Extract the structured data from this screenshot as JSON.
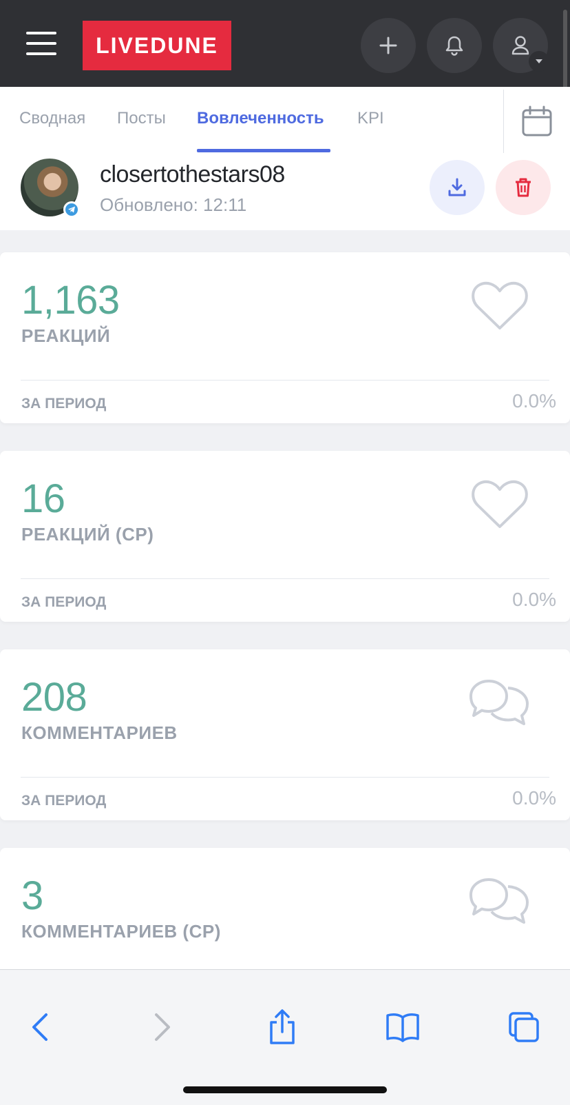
{
  "app": {
    "logo": "LIVEDUNE"
  },
  "tabs": [
    "Сводная",
    "Посты",
    "Вовлеченность",
    "KPI"
  ],
  "account": {
    "name": "closertothestars08",
    "updated": "Обновлено: 12:11"
  },
  "cards": [
    {
      "value": "1,163",
      "label": "РЕАКЦИЙ",
      "period_label": "ЗА ПЕРИОД",
      "change": "0.0%",
      "icon": "heart-icon"
    },
    {
      "value": "16",
      "label": "РЕАКЦИЙ (СР)",
      "period_label": "ЗА ПЕРИОД",
      "change": "0.0%",
      "icon": "heart-icon"
    },
    {
      "value": "208",
      "label": "КОММЕНТАРИЕВ",
      "period_label": "ЗА ПЕРИОД",
      "change": "0.0%",
      "icon": "comments-icon"
    },
    {
      "value": "3",
      "label": "КОММЕНТАРИЕВ (СР)",
      "period_label": "",
      "change": "",
      "icon": "comments-icon"
    }
  ],
  "colors": {
    "brand": "#e52b3f",
    "accent": "#4e6ae0",
    "value": "#5aab98",
    "topbar": "#2f3034",
    "safari_blue": "#2f7cf6"
  }
}
